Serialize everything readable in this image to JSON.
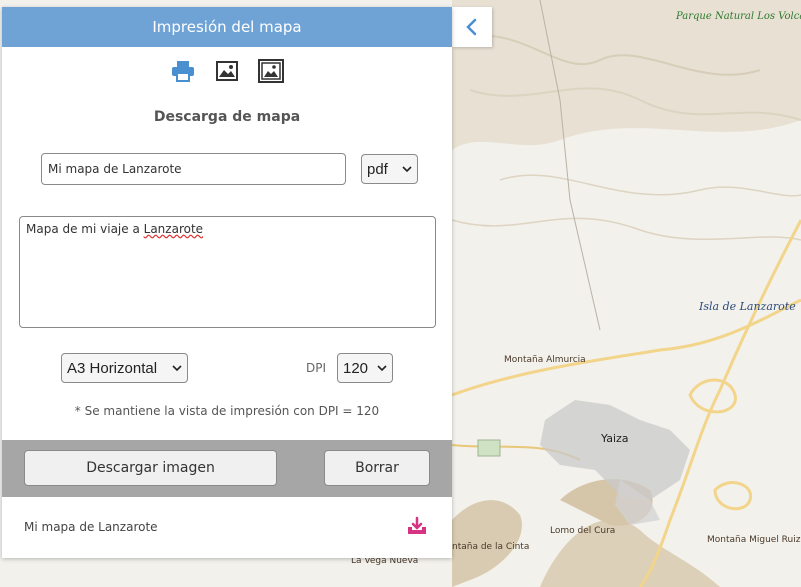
{
  "panel": {
    "title": "Impresión del mapa",
    "section_title": "Descarga de mapa",
    "mode_icons": [
      "printer-icon",
      "image-icon",
      "framed-image-icon"
    ],
    "map_title_value": "Mi mapa de Lanzarote",
    "format_selected": "pdf",
    "description_value_plain": "Mapa de mi viaje a ",
    "description_value_spell": "Lanzarote",
    "size_selected": "A3 Horizontal",
    "dpi_label": "DPI",
    "dpi_selected": "120",
    "dpi_note": "* Se mantiene la vista de impresión con DPI = 120",
    "download_button": "Descargar imagen",
    "clear_button": "Borrar",
    "result_name": "Mi mapa de Lanzarote",
    "result_download_icon": "download-icon",
    "collapse_icon": "chevron-left-icon"
  },
  "map": {
    "labels": {
      "park": "Parque Natural Los Volca",
      "island": "Isla de Lanzarote",
      "almucia": "Montaña Almurcia",
      "yaiza": "Yaiza",
      "lomo": "Lomo del Cura",
      "cinta": "ntaña de la Cinta",
      "miguel": "Montaña Miguel Ruiz",
      "vega": "La Vega Nueva"
    }
  },
  "colors": {
    "header": "#6fa3d6",
    "icon_blue": "#4a8fd0",
    "download_pink": "#d63384",
    "button_bar": "#a6a6a6",
    "road": "#f2d58a"
  }
}
